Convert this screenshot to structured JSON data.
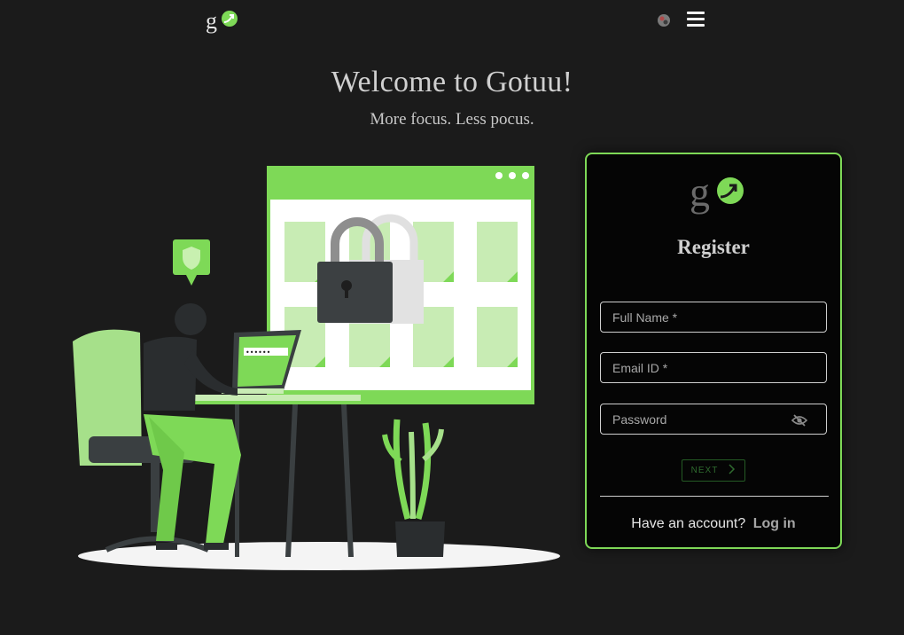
{
  "header": {
    "logo_icon": "gotuu-logo-icon",
    "globe_icon": "globe-icon",
    "menu_icon": "hamburger-menu-icon"
  },
  "hero": {
    "title": "Welcome to Gotuu!",
    "tagline": "More focus. Less pocus."
  },
  "illustration": {
    "name": "secure-login-illustration",
    "password_mask": "••••••",
    "accent_color": "#7ed957"
  },
  "register": {
    "title": "Register",
    "full_name_placeholder": "Full Name *",
    "email_placeholder": "Email ID *",
    "password_placeholder": "Password",
    "password_toggle_icon": "eye-off-icon",
    "next_label": "NEXT",
    "next_icon": "chevron-right-icon",
    "account_prompt": "Have an account?",
    "login_label": "Log in"
  },
  "colors": {
    "background": "#1b1b1b",
    "card_background": "#050505",
    "accent": "#7ed957",
    "next_button": "#245a24"
  }
}
